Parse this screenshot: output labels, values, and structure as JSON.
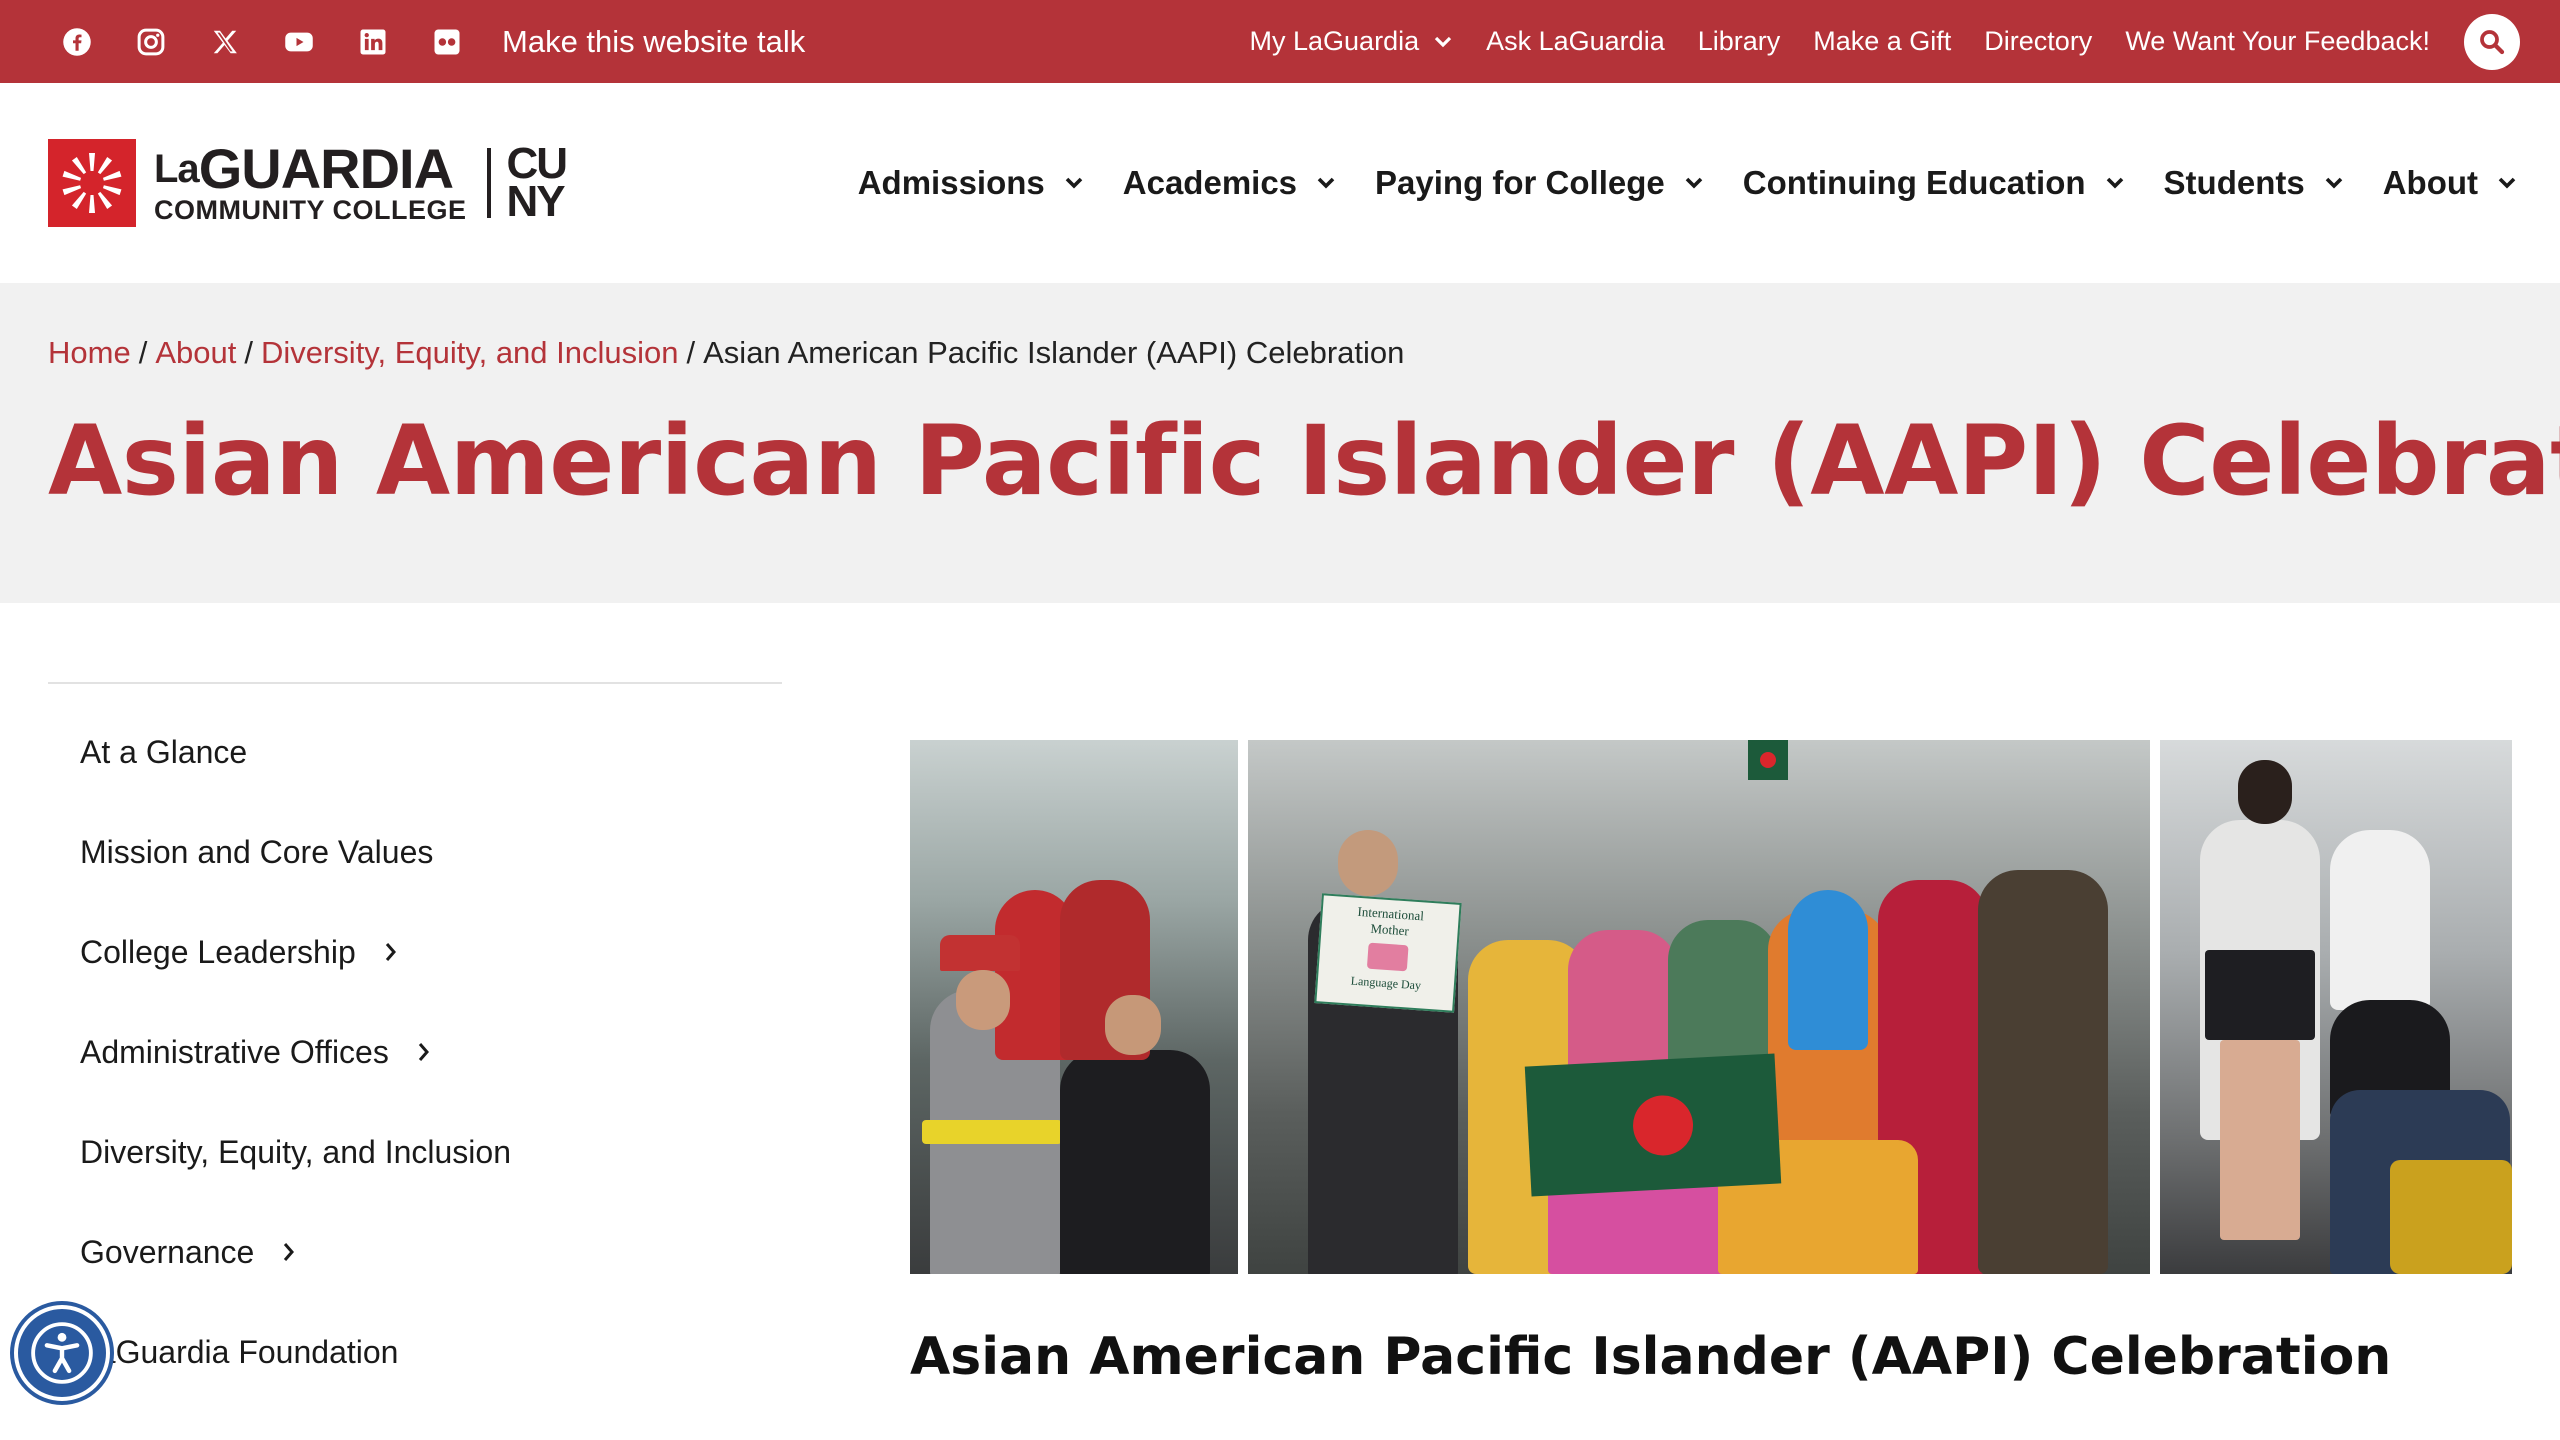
{
  "utility_bar": {
    "social_icons": [
      "facebook-icon",
      "instagram-icon",
      "x-icon",
      "youtube-icon",
      "linkedin-icon",
      "flickr-icon"
    ],
    "talk_label": "Make this website talk",
    "links": [
      {
        "label": "My LaGuardia",
        "has_dropdown": true
      },
      {
        "label": "Ask LaGuardia"
      },
      {
        "label": "Library"
      },
      {
        "label": "Make a Gift"
      },
      {
        "label": "Directory"
      },
      {
        "label": "We Want Your Feedback!"
      }
    ],
    "search_icon": "search-icon"
  },
  "header": {
    "logo": {
      "name_small": "La",
      "name": "GUARDIA",
      "subtitle": "COMMUNITY COLLEGE",
      "partner_line1": "CU",
      "partner_line2": "NY"
    },
    "nav": [
      {
        "label": "Admissions"
      },
      {
        "label": "Academics"
      },
      {
        "label": "Paying for College"
      },
      {
        "label": "Continuing Education"
      },
      {
        "label": "Students"
      },
      {
        "label": "About"
      }
    ]
  },
  "breadcrumb": {
    "items": [
      {
        "label": "Home",
        "link": true
      },
      {
        "label": "About",
        "link": true
      },
      {
        "label": "Diversity, Equity, and Inclusion",
        "link": true
      },
      {
        "label": "Asian American Pacific Islander (AAPI) Celebration",
        "link": false
      }
    ],
    "separator": "/"
  },
  "page": {
    "title": "Asian American Pacific Islander (AAPI) Celebration",
    "content_heading": "Asian American Pacific Islander (AAPI) Celebration",
    "photo_banner_text": {
      "sign_line1": "International",
      "sign_line2": "Mother",
      "sign_line3": "Language Day"
    }
  },
  "sidebar": {
    "items": [
      {
        "label": "At a Glance",
        "has_children": false
      },
      {
        "label": "Mission and Core Values",
        "has_children": false
      },
      {
        "label": "College Leadership",
        "has_children": true
      },
      {
        "label": "Administrative Offices",
        "has_children": true
      },
      {
        "label": "Diversity, Equity, and Inclusion",
        "has_children": false
      },
      {
        "label": "Governance",
        "has_children": true
      },
      {
        "label": "LaGuardia Foundation",
        "has_children": false
      }
    ]
  },
  "colors": {
    "brand_red": "#b43339",
    "logo_red": "#d4242b",
    "title_band": "#f1f1f1",
    "a11y_blue": "#2a5aa0"
  },
  "accessibility_button": {
    "icon": "accessibility-icon"
  }
}
